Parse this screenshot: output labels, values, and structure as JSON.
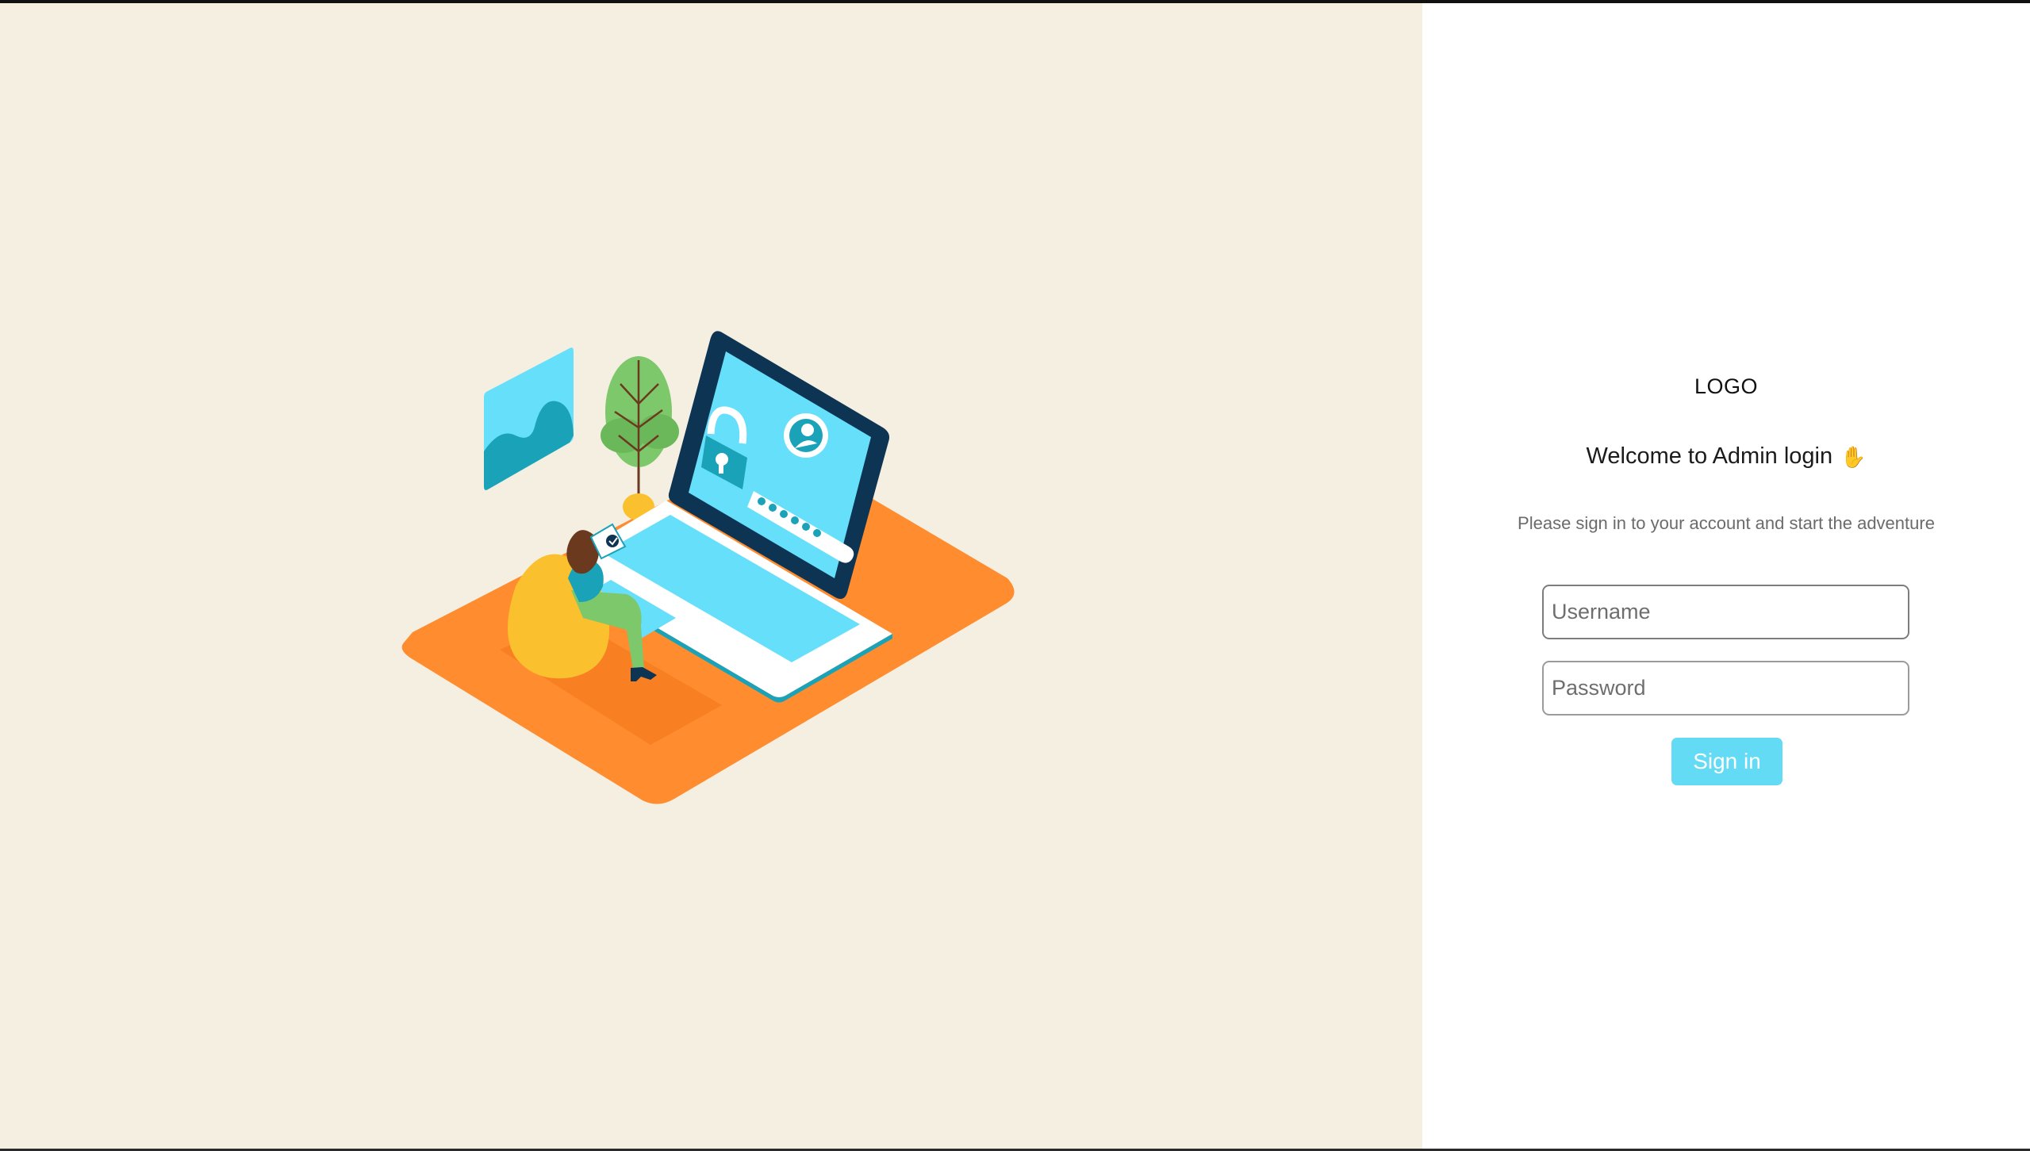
{
  "header": {
    "logo_text": "LOGO",
    "welcome_text": "Welcome to Admin login",
    "wave_icon": "waving-hand-icon",
    "subtitle": "Please sign in to your account and start the adventure"
  },
  "form": {
    "username_placeholder": "Username",
    "password_placeholder": "Password",
    "signin_label": "Sign in"
  },
  "colors": {
    "left_background": "#f5efe2",
    "accent_button": "#63dbf5",
    "platform_orange": "#ff8c2e",
    "screen_cyan": "#66dffb",
    "laptop_frame": "#0d3553",
    "chair_yellow": "#fbc02d"
  }
}
